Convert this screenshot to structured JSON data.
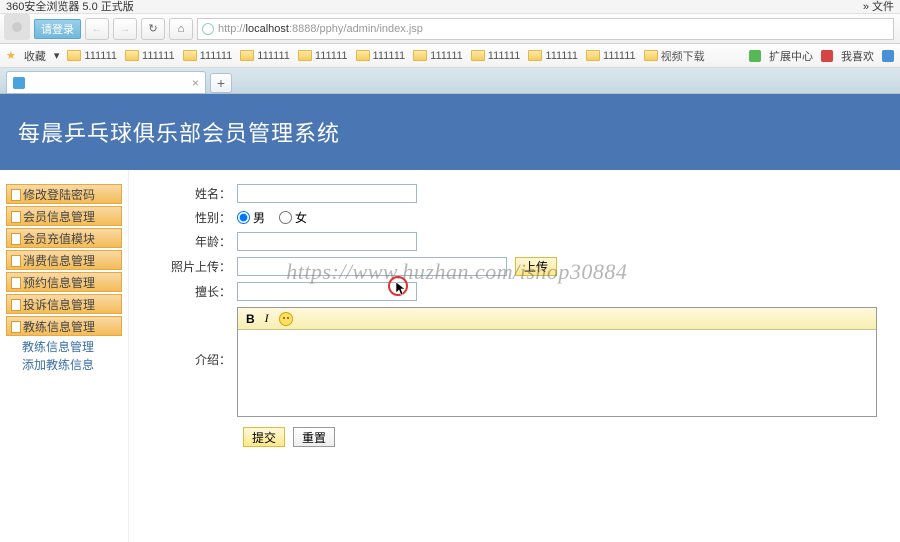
{
  "browser": {
    "title": "360安全浏览器 5.0 正式版",
    "file_menu": "文件",
    "login_btn": "请登录",
    "url_prefix": "http://",
    "url_host": "localhost",
    "url_rest": ":8888/pphy/admin/index.jsp",
    "bookmarks_label": "收藏",
    "bookmark_items": [
      "111111",
      "111111",
      "111111",
      "111111",
      "111111",
      "111111",
      "111111",
      "111111",
      "111111",
      "111111"
    ],
    "video_dl": "视频下载",
    "ext_center": "扩展中心",
    "like": "我喜欢",
    "tab_title": "",
    "newtab": "+"
  },
  "app": {
    "header_title": "每晨乒乓球俱乐部会员管理系统"
  },
  "sidebar": {
    "items": [
      {
        "label": "修改登陆密码"
      },
      {
        "label": "会员信息管理"
      },
      {
        "label": "会员充值模块"
      },
      {
        "label": "消费信息管理"
      },
      {
        "label": "预约信息管理"
      },
      {
        "label": "投诉信息管理"
      },
      {
        "label": "教练信息管理"
      }
    ],
    "subs": [
      {
        "label": "教练信息管理"
      },
      {
        "label": "添加教练信息"
      }
    ]
  },
  "form": {
    "name_label": "姓名：",
    "gender_label": "性别：",
    "gender_male": "男",
    "gender_female": "女",
    "age_label": "年龄：",
    "photo_label": "照片上传：",
    "upload_btn": "上传",
    "strength_label": "擅长：",
    "intro_label": "介绍：",
    "submit": "提交",
    "reset": "重置",
    "editor_b": "B",
    "editor_i": "I"
  },
  "watermark": "https://www.huzhan.com/ishop30884"
}
